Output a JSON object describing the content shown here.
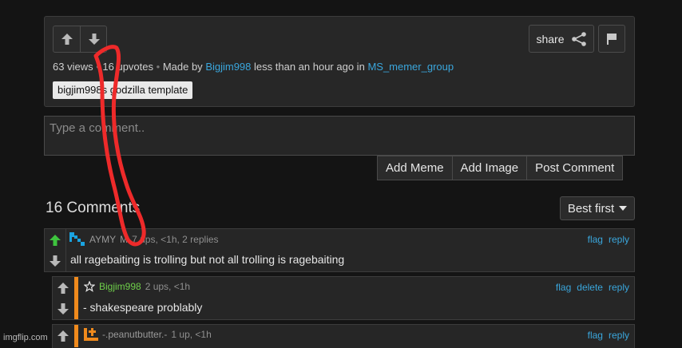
{
  "meme": {
    "share_label": "share",
    "views": "63 views",
    "upvotes": "16 upvotes",
    "made_by_prefix": "Made by",
    "author": "Bigjim998",
    "time": "less than an hour ago in",
    "stream": "MS_memer_group",
    "tag": "bigjim998s godzilla template"
  },
  "comment_box": {
    "placeholder": "Type a comment..",
    "buttons": [
      "Add Meme",
      "Add Image",
      "Post Comment"
    ]
  },
  "comments_header": {
    "count": "16 Comments",
    "sort": "Best first"
  },
  "comments": [
    {
      "username": "AYMY",
      "extra": "M",
      "meta": "7 ups, <1h, 2 replies",
      "text": "all ragebaiting is trolling but not all trolling is ragebaiting",
      "actions": [
        "flag",
        "reply"
      ]
    },
    {
      "username": "Bigjim998",
      "meta": "2 ups, <1h",
      "text": "- shakespeare problably",
      "actions": [
        "flag",
        "delete",
        "reply"
      ]
    },
    {
      "username": "-.peanutbutter.-",
      "meta": "1 up, <1h",
      "actions": [
        "flag",
        "reply"
      ]
    }
  ],
  "watermark": "imgflip.com",
  "colors": {
    "accent_blue": "#3aa6dc",
    "upvote_green": "#3ec43e",
    "reply_stripe": "#f08a1c",
    "scribble_red": "#ee2a2a"
  }
}
